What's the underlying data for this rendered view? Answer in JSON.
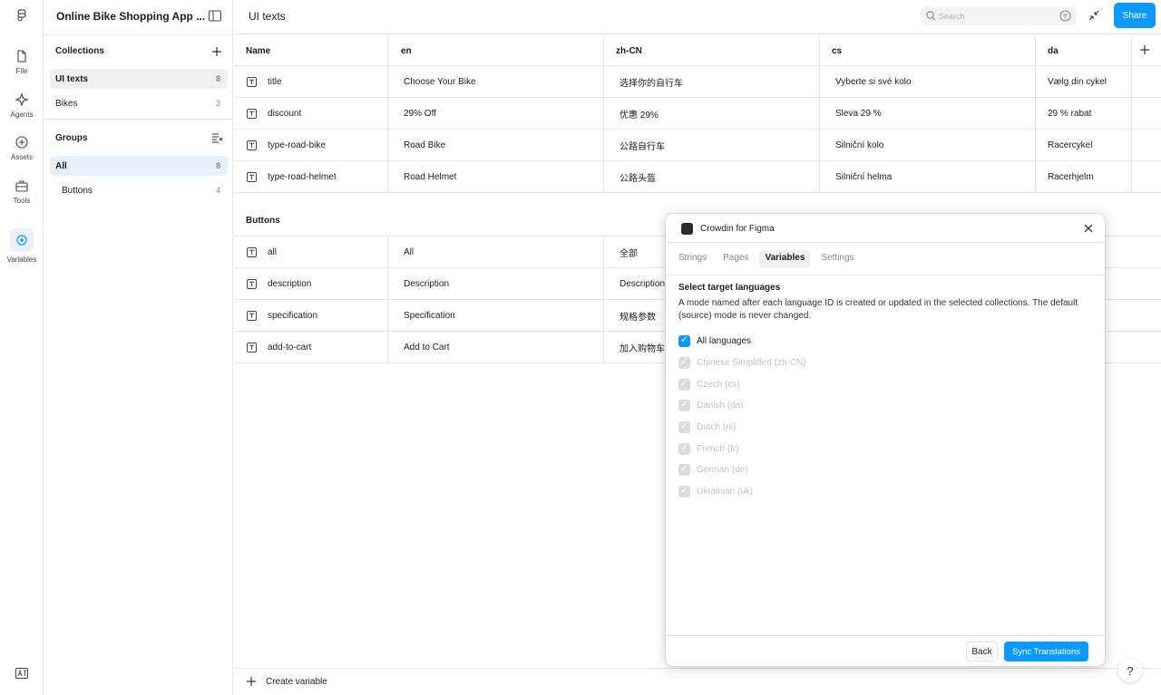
{
  "app": {
    "doc_title": "Online Bike Shopping App ...",
    "rail": {
      "file": "File",
      "agents": "Agents",
      "assets": "Assets",
      "tools": "Tools",
      "variables": "Variables"
    }
  },
  "collections": {
    "title": "Collections",
    "items": [
      {
        "label": "UI texts",
        "count": "8"
      },
      {
        "label": "Bikes",
        "count": "3"
      }
    ]
  },
  "groups": {
    "title": "Groups",
    "items": [
      {
        "label": "All",
        "count": "8"
      },
      {
        "label": "Buttons",
        "count": "4"
      }
    ]
  },
  "main": {
    "title": "UI texts",
    "search_placeholder": "Search",
    "share_label": "Share",
    "columns": [
      "Name",
      "en",
      "zh-CN",
      "cs",
      "da"
    ],
    "rows": [
      {
        "name": "title",
        "en": "Choose Your Bike",
        "zh": "选择你的自行车",
        "cs": "Vyberte si své kolo",
        "da": "Vælg din cykel"
      },
      {
        "name": "discount",
        "en": "29% Off",
        "zh": "优惠 29%",
        "cs": "Sleva 29 %",
        "da": "29 % rabat"
      },
      {
        "name": "type-road-bike",
        "en": "Road Bike",
        "zh": "公路自行车",
        "cs": "Silniční kolo",
        "da": "Racercykel"
      },
      {
        "name": "type-road-helmet",
        "en": "Road Helmet",
        "zh": "公路头盔",
        "cs": "Silniční helma",
        "da": "Racerhjelm"
      }
    ],
    "group_label": "Buttons",
    "button_rows": [
      {
        "name": "all",
        "en": "All",
        "zh": "全部"
      },
      {
        "name": "description",
        "en": "Description",
        "zh": "Description"
      },
      {
        "name": "specification",
        "en": "Specification",
        "zh": "规格参数"
      },
      {
        "name": "add-to-cart",
        "en": "Add to Cart",
        "zh": "加入购物车"
      }
    ],
    "create_variable": "Create variable",
    "help": "?"
  },
  "dialog": {
    "title": "Crowdin for Figma",
    "tabs": [
      "Strings",
      "Pages",
      "Variables",
      "Settings"
    ],
    "active_tab": "Variables",
    "section_title": "Select target languages",
    "description": "A mode named after each language ID is created or updated in the selected collections. The default (source) mode is never changed.",
    "all_languages": "All languages",
    "languages": [
      "Chinese Simplified (zh-CN)",
      "Czech (cs)",
      "Danish (da)",
      "Dutch (nl)",
      "French (fr)",
      "German (de)",
      "Ukrainian (uk)"
    ],
    "back_label": "Back",
    "sync_label": "Sync Translations"
  },
  "colors": {
    "accent": "#0d99ff",
    "selected_blue": "#e5f1fb"
  }
}
